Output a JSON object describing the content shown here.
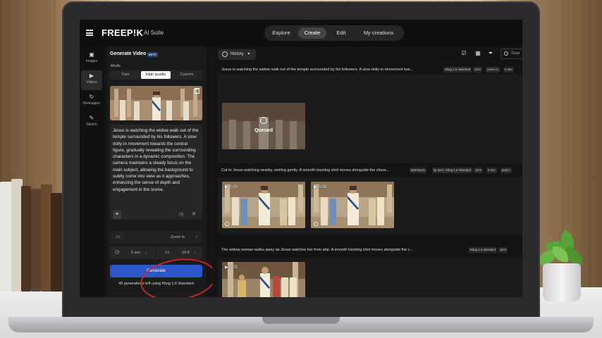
{
  "app": {
    "logo": "FREEP!K",
    "logo_sub": "AI Suite"
  },
  "nav": {
    "items": [
      "Explore",
      "Create",
      "Edit",
      "My creations"
    ],
    "active": "Create"
  },
  "rail": {
    "items": [
      {
        "label": "Images",
        "icon": "image-icon"
      },
      {
        "label": "Videos",
        "icon": "video-icon"
      },
      {
        "label": "Reimagine",
        "icon": "reimagine-icon"
      },
      {
        "label": "Sketch",
        "icon": "sketch-icon"
      }
    ],
    "active": "Videos"
  },
  "panel": {
    "title": "Generate Video",
    "badge": "BETA",
    "mode_label": "Mode",
    "modes": [
      "Fast",
      "High quality",
      "Custom"
    ],
    "active_mode": "High quality",
    "prompt": "Jesus is watching the widow walk out of the temple surrounded by his followers. A slow dolly-in movement towards the central figure, gradually revealing the surrounding characters in a dynamic composition. The camera maintains a steady focus on the main subject, allowing the background to subtly come into view as it approaches, enhancing the sense of depth and engagement in the scene.",
    "camera_value": "Zoom in",
    "duration_value": "5 sec",
    "ratio_value": "16:9",
    "generate_label": "Generate",
    "generations_note": "40 generations left using Kling 1.6 Standard"
  },
  "main": {
    "history_label": "History",
    "search_placeholder": "Sear",
    "rows": [
      {
        "prompt": "Jesus is watching the widow walk out of the temple surrounded by his followers. A slow dolly-in movement tow...",
        "tags": [
          "Kling 1.6 standard",
          "16:9",
          "zoom in",
          "5 sec"
        ],
        "status": "Queued"
      },
      {
        "prompt": "Cut to Jesus watching nearby, smiling gently. A smooth tracking shot moves alongside the chara...",
        "tags": [
          "latentsync",
          "lip sync",
          "Kling 1.6 standard",
          "16:9",
          "5 sec",
          "push i"
        ],
        "durations": [
          "0:05",
          "0:05"
        ]
      },
      {
        "prompt": "The widow woman walks away as Jesus watches her from afar. A smooth tracking shot moves alongside the c...",
        "tags": [
          "Kling 1.6 standard",
          "16:9"
        ],
        "durations": [
          "0:05"
        ]
      }
    ]
  },
  "colors": {
    "accent": "#2d56c9",
    "annotation": "#c9242a"
  }
}
